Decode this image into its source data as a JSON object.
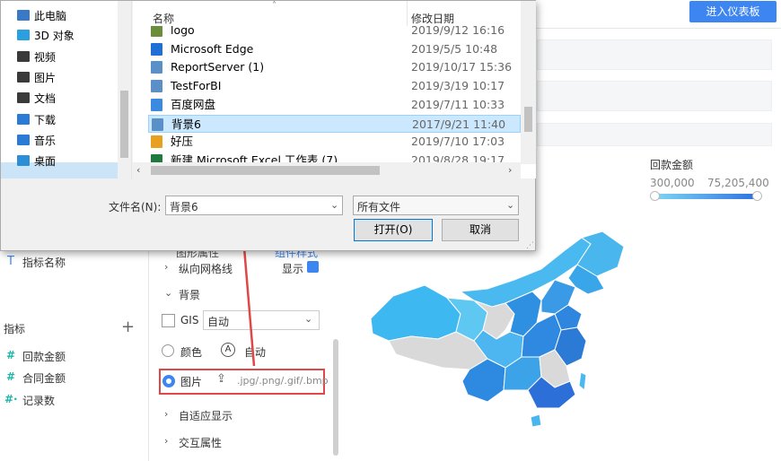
{
  "top_button": "进入仪表板",
  "nav_tree": [
    {
      "label": "此电脑",
      "icon": "computer-icon",
      "color": "#3a78c8"
    },
    {
      "label": "3D 对象",
      "icon": "3d-objects-icon",
      "color": "#2aa0e0"
    },
    {
      "label": "视频",
      "icon": "video-folder-icon",
      "color": "#3a3a3a"
    },
    {
      "label": "图片",
      "icon": "pictures-folder-icon",
      "color": "#3a3a3a"
    },
    {
      "label": "文档",
      "icon": "documents-folder-icon",
      "color": "#3a3a3a"
    },
    {
      "label": "下载",
      "icon": "download-arrow-icon",
      "color": "#2a7ad6"
    },
    {
      "label": "音乐",
      "icon": "music-note-icon",
      "color": "#2a7ad6"
    },
    {
      "label": "桌面",
      "icon": "desktop-icon",
      "color": "#2a8fd6"
    }
  ],
  "file_list": {
    "col_name": "名称",
    "col_modified": "修改日期",
    "rows": [
      {
        "name": "logo",
        "date": "2019/9/12 16:16",
        "icon": "image-file-icon",
        "color": "#6b8e3a"
      },
      {
        "name": "Microsoft Edge",
        "date": "2019/5/5 10:48",
        "icon": "edge-icon",
        "color": "#1f6fd6"
      },
      {
        "name": "ReportServer (1)",
        "date": "2019/10/17 15:36",
        "icon": "image-file-icon",
        "color": "#5a8fc8"
      },
      {
        "name": "TestForBI",
        "date": "2019/3/19 10:17",
        "icon": "image-file-icon",
        "color": "#5a8fc8"
      },
      {
        "name": "百度网盘",
        "date": "2019/7/11 10:33",
        "icon": "baidu-netdisk-icon",
        "color": "#3a8ae0"
      },
      {
        "name": "背景6",
        "date": "2017/9/21 11:40",
        "icon": "image-file-icon",
        "color": "#5a8fc8",
        "selected": true
      },
      {
        "name": "好压",
        "date": "2019/7/10 17:03",
        "icon": "haozip-icon",
        "color": "#e8a020"
      },
      {
        "name": "新建 Microsoft Excel 工作表 (7)",
        "date": "2019/8/28 19:17",
        "icon": "excel-icon",
        "color": "#1f7a40"
      }
    ]
  },
  "filename_label": "文件名(N):",
  "filename_value": "背景6",
  "file_type": "所有文件",
  "open_button": "打开(O)",
  "cancel_button": "取消",
  "left_panel": {
    "dimension_item": "指标名称",
    "metrics_header": "指标",
    "metrics": [
      "回款金额",
      "合同金额",
      "记录数"
    ]
  },
  "settings_panel": {
    "tab_left": "图形属性",
    "tab_right": "组件样式",
    "gridline_label": "纵向网格线",
    "gridline_value": "显示",
    "background_section": "背景",
    "gis_label": "GIS",
    "gis_value": "自动",
    "color_label": "颜色",
    "color_value": "自动",
    "image_label": "图片",
    "image_hint": ".jpg/.png/.gif/.bmp",
    "adaptive_section": "自适应显示",
    "interaction_section": "交互属性"
  },
  "map_legend": {
    "title": "回款金额",
    "min": "300,000",
    "max": "75,205,400",
    "color_start": "#7fd6f5",
    "color_end": "#2d6fe0"
  },
  "accent_color": "#3d85f0"
}
